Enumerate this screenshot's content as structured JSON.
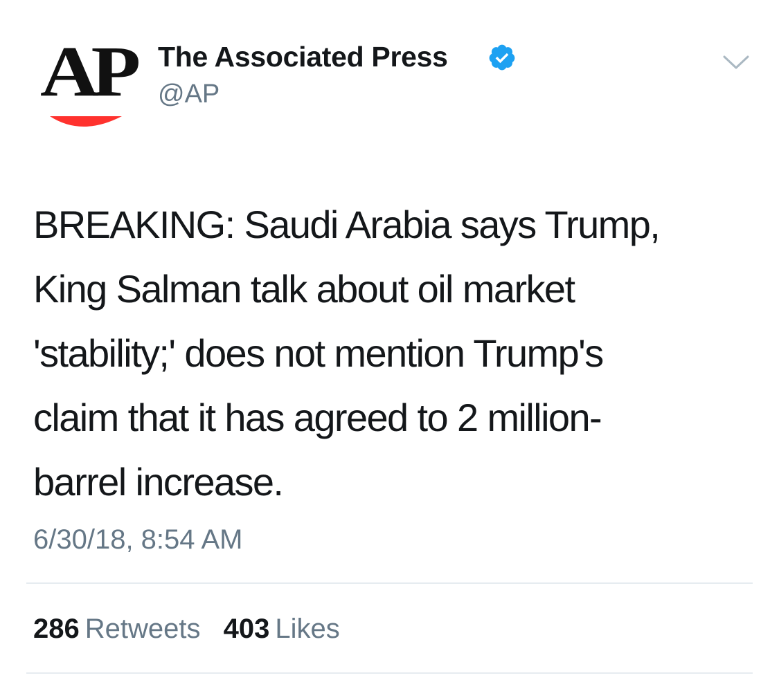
{
  "tweet": {
    "account": {
      "logo_text": "AP",
      "display_name": "The Associated Press",
      "handle": "@AP",
      "verified": true,
      "avatar_icon": "ap-logo-icon",
      "verified_icon": "verified-badge-icon",
      "menu_icon": "chevron-down-icon"
    },
    "text": "BREAKING: Saudi Arabia says Trump,\nKing Salman talk about oil market\n'stability;' does not mention Trump's\nclaim that it has agreed to 2 million-\nbarrel increase.",
    "timestamp": "6/30/18, 8:54 AM",
    "stats": {
      "retweets_count": "286",
      "retweets_label": "Retweets",
      "likes_count": "403",
      "likes_label": "Likes"
    }
  },
  "colors": {
    "text_primary": "#14171a",
    "text_secondary": "#657786",
    "verified_blue": "#1da1f2",
    "ap_red": "#ff322e",
    "divider": "#e6ecf0"
  }
}
